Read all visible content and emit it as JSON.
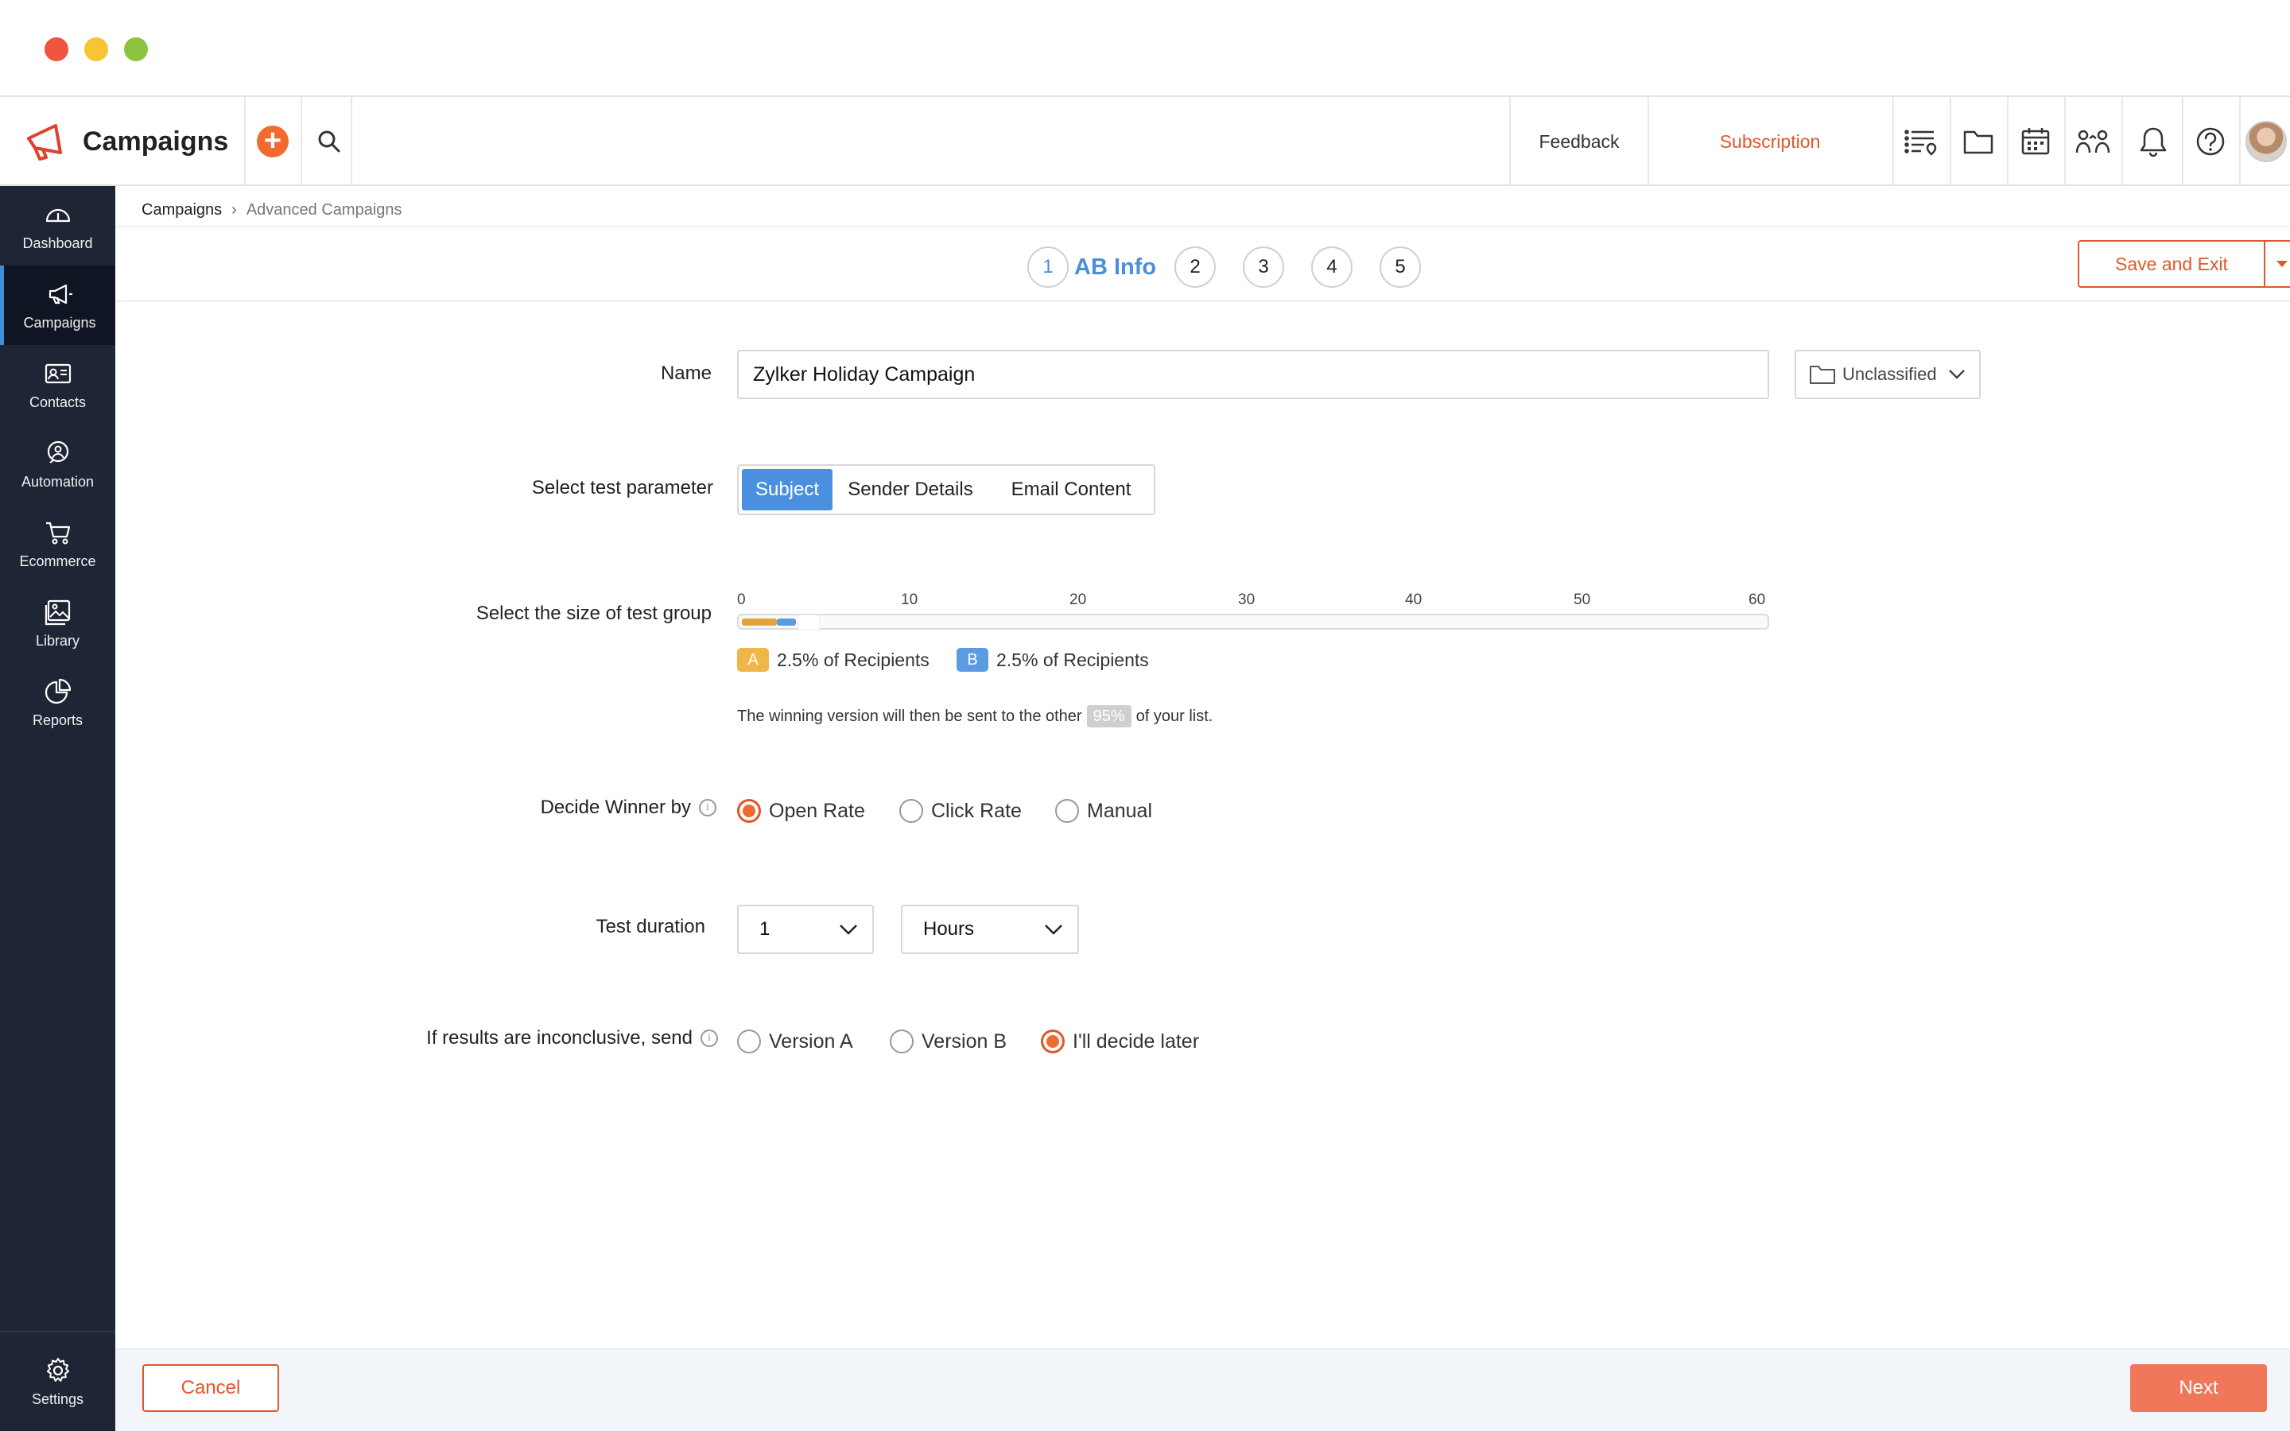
{
  "window": {
    "controls": [
      "close",
      "minimize",
      "zoom"
    ]
  },
  "header": {
    "app_title": "Campaigns",
    "feedback": "Feedback",
    "subscription": "Subscription",
    "icons": [
      "list-icon",
      "folder-icon",
      "calendar-icon",
      "users-icon",
      "bell-icon",
      "help-icon"
    ]
  },
  "sidebar": {
    "items": [
      {
        "label": "Dashboard",
        "icon": "gauge-icon"
      },
      {
        "label": "Campaigns",
        "icon": "megaphone-icon",
        "active": true
      },
      {
        "label": "Contacts",
        "icon": "contact-card-icon"
      },
      {
        "label": "Automation",
        "icon": "automation-icon"
      },
      {
        "label": "Ecommerce",
        "icon": "cart-icon"
      },
      {
        "label": "Library",
        "icon": "image-library-icon"
      },
      {
        "label": "Reports",
        "icon": "pie-chart-icon"
      }
    ],
    "settings": "Settings"
  },
  "breadcrumb": {
    "root": "Campaigns",
    "current": "Advanced Campaigns"
  },
  "steps": {
    "numbers": [
      "1",
      "2",
      "3",
      "4",
      "5"
    ],
    "active_title": "AB Info",
    "active": 1
  },
  "actions": {
    "save_exit": "Save and Exit"
  },
  "form": {
    "name_label": "Name",
    "name_value": "Zylker Holiday Campaign",
    "folder": "Unclassified",
    "test_param_label": "Select test parameter",
    "test_params": [
      "Subject",
      "Sender Details",
      "Email Content"
    ],
    "test_param_selected": "Subject",
    "group_size_label": "Select the size of test group",
    "ticks": [
      "0",
      "10",
      "20",
      "30",
      "40",
      "50",
      "60"
    ],
    "slider_value_percent": 5,
    "group_a_badge": "A",
    "group_a_text": "2.5% of Recipients",
    "group_b_badge": "B",
    "group_b_text": "2.5% of Recipients",
    "winning_prefix": "The winning version will then be sent to the other",
    "winning_pct": "95%",
    "winning_suffix": "of your list.",
    "decide_label": "Decide Winner by",
    "decide_options": [
      "Open Rate",
      "Click Rate",
      "Manual"
    ],
    "decide_selected": "Open Rate",
    "duration_label": "Test duration",
    "duration_value": "1",
    "duration_unit": "Hours",
    "inconclusive_label": "If results are inconclusive, send",
    "inconclusive_options": [
      "Version A",
      "Version B",
      "I'll decide later"
    ],
    "inconclusive_selected": "I'll decide later"
  },
  "footer": {
    "cancel": "Cancel",
    "next": "Next"
  },
  "colors": {
    "accent": "#e0582a",
    "primary": "#4a90de",
    "sidebar": "#1e2535",
    "group_a": "#efb64a",
    "group_b": "#5c9be0"
  }
}
